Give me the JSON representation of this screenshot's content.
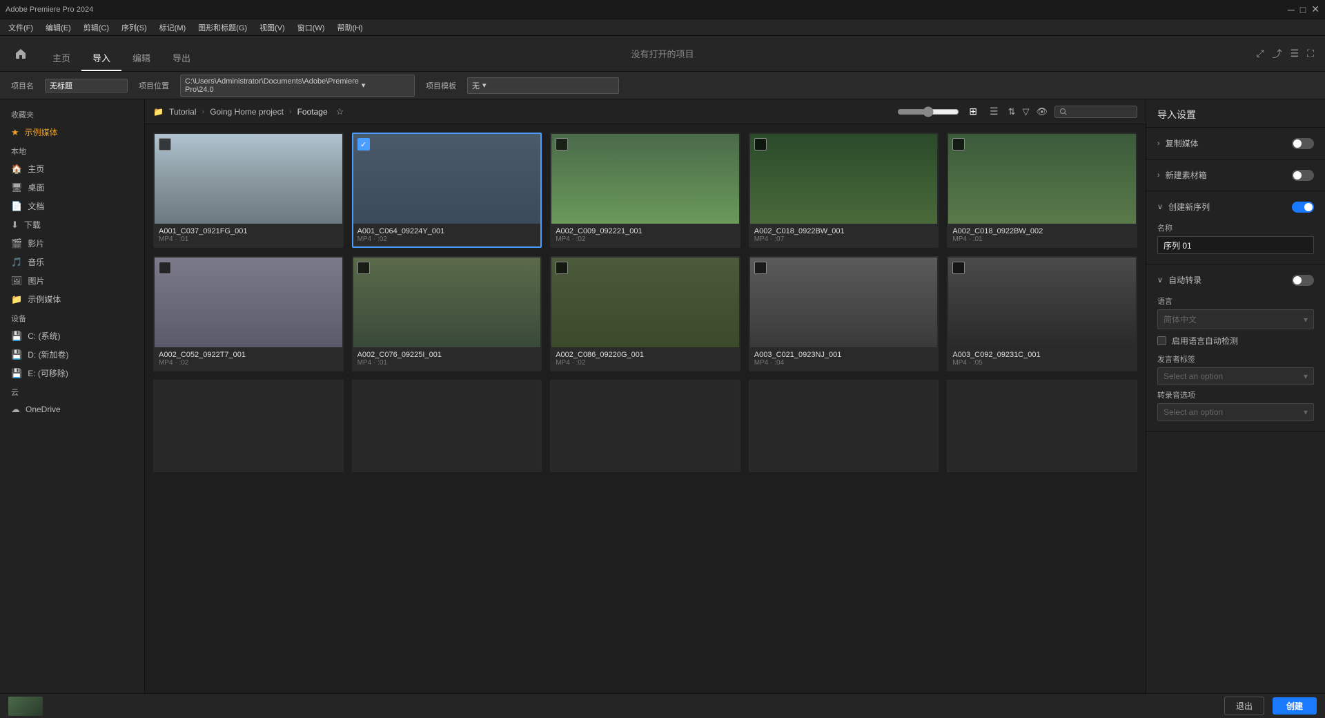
{
  "titlebar": {
    "title": "Adobe Premiere Pro 2024",
    "controls": [
      "minimize",
      "maximize",
      "close"
    ]
  },
  "menubar": {
    "items": [
      "文件(F)",
      "编辑(E)",
      "剪辑(C)",
      "序列(S)",
      "标记(M)",
      "图形和标题(G)",
      "视图(V)",
      "窗口(W)",
      "帮助(H)"
    ]
  },
  "toolbar": {
    "home_label": "主页",
    "import_label": "导入",
    "edit_label": "编辑",
    "export_label": "导出",
    "center_title": "没有打开的项目"
  },
  "projectbar": {
    "project_name_label": "项目名",
    "project_name_value": "无标题",
    "project_location_label": "项目位置",
    "project_location_value": "C:\\Users\\Administrator\\Documents\\Adobe\\Premiere Pro\\24.0",
    "template_label": "项目模板",
    "template_value": "无"
  },
  "sidebar": {
    "favorites_header": "收藏夹",
    "example_media_label": "示例媒体",
    "local_header": "本地",
    "items": [
      {
        "id": "home",
        "label": "主页",
        "icon": "🏠"
      },
      {
        "id": "desktop",
        "label": "桌面",
        "icon": "🖥"
      },
      {
        "id": "documents",
        "label": "文档",
        "icon": "📄"
      },
      {
        "id": "downloads",
        "label": "下载",
        "icon": "⬇"
      },
      {
        "id": "movies",
        "label": "影片",
        "icon": "🎬"
      },
      {
        "id": "music",
        "label": "音乐",
        "icon": "🎵"
      },
      {
        "id": "pictures",
        "label": "图片",
        "icon": "🖼"
      },
      {
        "id": "sample-media",
        "label": "示例媒体",
        "icon": "📁"
      }
    ],
    "devices_header": "设备",
    "devices": [
      {
        "id": "c-drive",
        "label": "C: (系统)",
        "icon": "💾"
      },
      {
        "id": "d-drive",
        "label": "D: (新加卷)",
        "icon": "💾"
      },
      {
        "id": "e-drive",
        "label": "E: (可移除)",
        "icon": "💾"
      }
    ],
    "cloud_header": "云",
    "cloud_items": [
      {
        "id": "onedrive",
        "label": "OneDrive",
        "icon": "☁"
      }
    ]
  },
  "breadcrumb": {
    "folder_icon": "📁",
    "items": [
      "Tutorial",
      "Going Home project",
      "Footage"
    ],
    "separators": [
      ">",
      ">"
    ]
  },
  "media_grid": {
    "row1": [
      {
        "id": "card-1",
        "name": "A001_C037_0921FG_001",
        "meta": "MP4 · :01",
        "selected": false,
        "thumb_class": "cross-bg"
      },
      {
        "id": "card-2",
        "name": "A001_C064_09224Y_001",
        "meta": "MP4 · :02",
        "selected": true,
        "thumb_class": "soccer-bg"
      },
      {
        "id": "card-3",
        "name": "A002_C009_092221_001",
        "meta": "MP4 · :02",
        "selected": false,
        "thumb_class": "aerial-bg"
      },
      {
        "id": "card-4",
        "name": "A002_C018_0922BW_001",
        "meta": "MP4 · :07",
        "selected": false,
        "thumb_class": "forest-bg"
      },
      {
        "id": "card-5",
        "name": "A002_C018_0922BW_002",
        "meta": "MP4 · :01",
        "selected": false,
        "thumb_class": "ruins-bg"
      }
    ],
    "row2": [
      {
        "id": "card-6",
        "name": "A002_C052_0922T7_001",
        "meta": "MP4 · :02",
        "selected": false,
        "thumb_class": "rocky-bg"
      },
      {
        "id": "card-7",
        "name": "A002_C076_09225I_001",
        "meta": "MP4 · :01",
        "selected": false,
        "thumb_class": "fence-bg"
      },
      {
        "id": "card-8",
        "name": "A002_C086_09220G_001",
        "meta": "MP4 · :02",
        "selected": false,
        "thumb_class": "animal-bg"
      },
      {
        "id": "card-9",
        "name": "A003_C021_0923NJ_001",
        "meta": "MP4 · :04",
        "selected": false,
        "thumb_class": "village-bg"
      },
      {
        "id": "card-10",
        "name": "A003_C092_09231C_001",
        "meta": "MP4 · :05",
        "selected": false,
        "thumb_class": "people-bg"
      }
    ],
    "row3": [
      {
        "id": "card-11",
        "name": "",
        "meta": "",
        "selected": false,
        "thumb_class": "partial-bg"
      },
      {
        "id": "card-12",
        "name": "",
        "meta": "",
        "selected": false,
        "thumb_class": "partial-bg"
      },
      {
        "id": "card-13",
        "name": "",
        "meta": "",
        "selected": false,
        "thumb_class": "partial-bg"
      },
      {
        "id": "card-14",
        "name": "",
        "meta": "",
        "selected": false,
        "thumb_class": "partial-bg"
      },
      {
        "id": "card-15",
        "name": "",
        "meta": "",
        "selected": false,
        "thumb_class": "partial-bg"
      }
    ]
  },
  "right_panel": {
    "title": "导入设置",
    "copy_media": {
      "label": "复制媒体",
      "toggle": false
    },
    "new_bin": {
      "label": "新建素材箱",
      "toggle": false
    },
    "create_sequence": {
      "label": "创建新序列",
      "toggle": true
    },
    "name_label": "名称",
    "name_value": "序列 01",
    "auto_transcode": {
      "label": "自动转录",
      "toggle": false
    },
    "language_label": "语言",
    "language_value": "简体中文",
    "auto_detect_label": "启用语言自动检测",
    "speaker_label": "发言者标签",
    "speaker_placeholder": "Select an option",
    "transcribe_label": "转录音选项",
    "transcribe_placeholder": "Select an option"
  },
  "bottombar": {
    "exit_label": "退出",
    "create_label": "创建"
  }
}
